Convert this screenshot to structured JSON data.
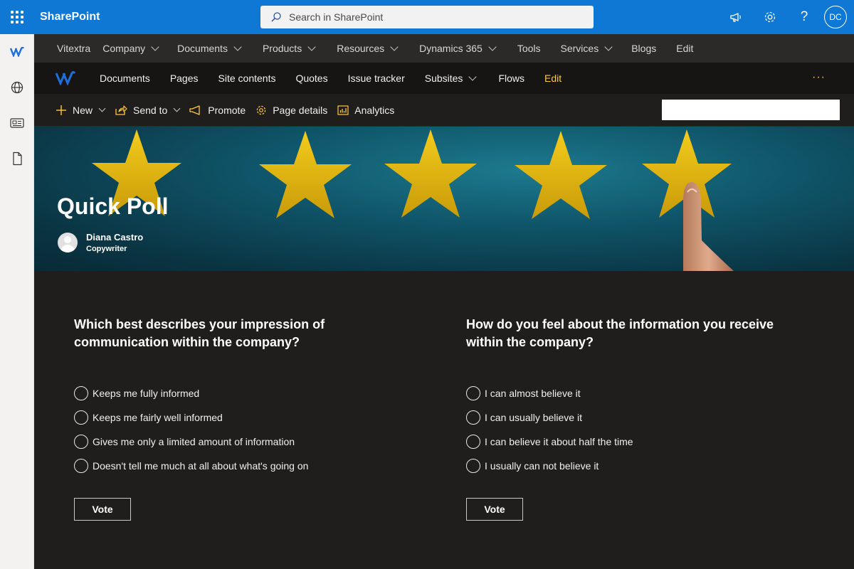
{
  "suite": {
    "app_title": "SharePoint",
    "search_placeholder": "Search in SharePoint",
    "avatar_initials": "DC",
    "accent": "#0f78d4"
  },
  "hub_nav": {
    "items": [
      {
        "label": "Vitextra",
        "dropdown": false
      },
      {
        "label": "Company",
        "dropdown": true
      },
      {
        "label": "Documents",
        "dropdown": true
      },
      {
        "label": "Products",
        "dropdown": true
      },
      {
        "label": "Resources",
        "dropdown": true
      },
      {
        "label": "Dynamics 365",
        "dropdown": true
      },
      {
        "label": "Tools",
        "dropdown": false
      },
      {
        "label": "Services",
        "dropdown": true
      },
      {
        "label": "Blogs",
        "dropdown": false
      },
      {
        "label": "Edit",
        "dropdown": false
      }
    ]
  },
  "site_nav": {
    "items": [
      {
        "label": "Documents",
        "dropdown": false
      },
      {
        "label": "Pages",
        "dropdown": false
      },
      {
        "label": "Site contents",
        "dropdown": false
      },
      {
        "label": "Quotes",
        "dropdown": false
      },
      {
        "label": "Issue tracker",
        "dropdown": false
      },
      {
        "label": "Subsites",
        "dropdown": true
      },
      {
        "label": "Flows",
        "dropdown": false
      },
      {
        "label": "Edit",
        "dropdown": false
      }
    ],
    "more": "···",
    "edit_color": "#ffc83d"
  },
  "command_bar": {
    "new": "New",
    "send_to": "Send to",
    "promote": "Promote",
    "page_details": "Page details",
    "analytics": "Analytics",
    "icon_color": "#ffc83d"
  },
  "banner": {
    "title": "Quick Poll",
    "author_name": "Diana Castro",
    "author_role": "Copywriter"
  },
  "polls": [
    {
      "question": "Which best describes your impression of communication within the company?",
      "options": [
        "Keeps me fully informed",
        "Keeps me fairly well informed",
        "Gives me only a limited amount of information",
        "Doesn't tell me much at all about what's going on"
      ],
      "vote_label": "Vote"
    },
    {
      "question": "How do you feel about the information you receive within the company?",
      "options": [
        "I can almost believe it",
        "I can usually believe it",
        "I can believe it about half the time",
        "I usually can not believe it"
      ],
      "vote_label": "Vote"
    }
  ]
}
